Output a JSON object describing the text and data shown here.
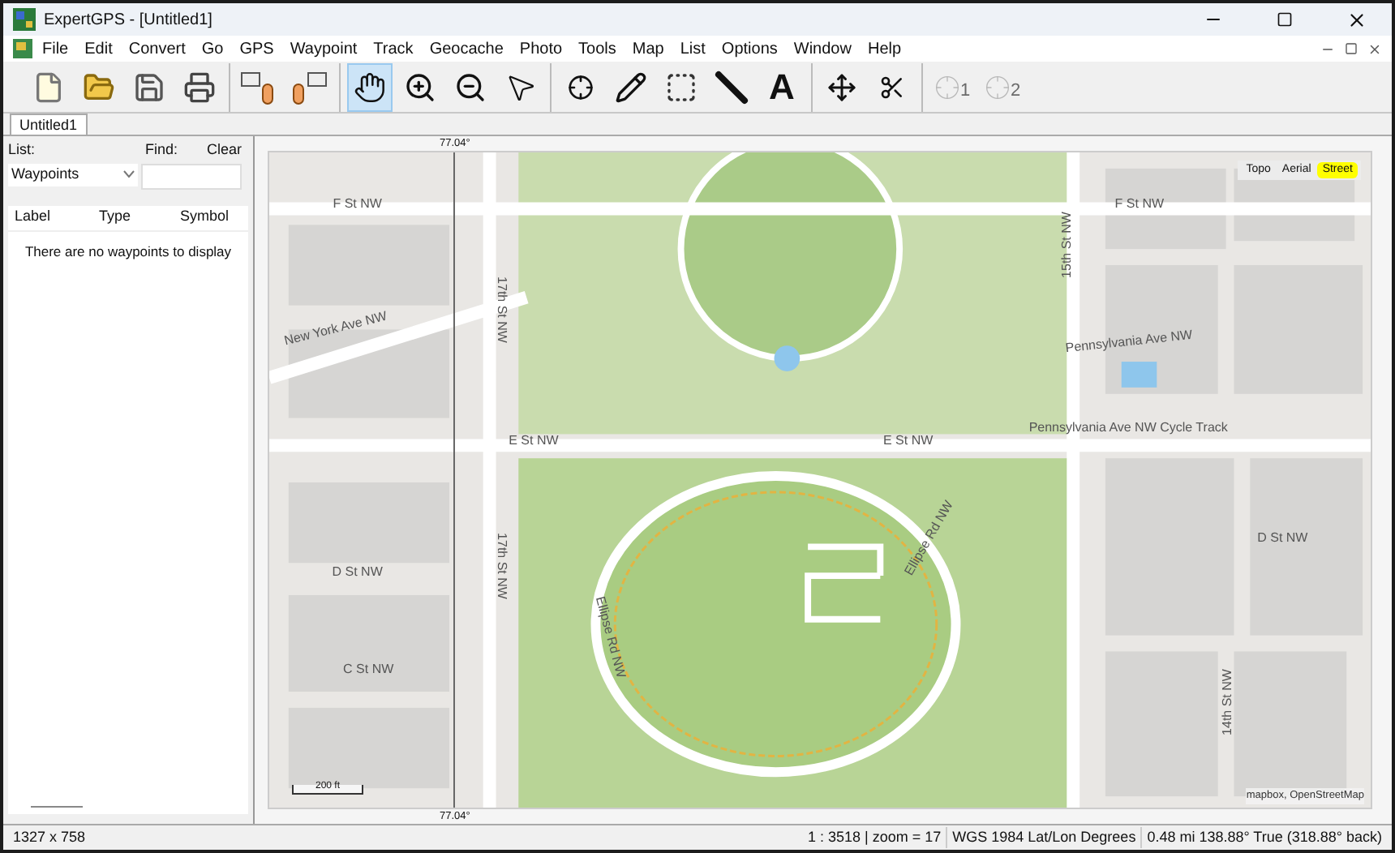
{
  "window": {
    "title": "ExpertGPS - [Untitled1]"
  },
  "menu": [
    "File",
    "Edit",
    "Convert",
    "Go",
    "GPS",
    "Waypoint",
    "Track",
    "Geocache",
    "Photo",
    "Tools",
    "Map",
    "List",
    "Options",
    "Window",
    "Help"
  ],
  "toolbar": [
    [
      {
        "kind": "new",
        "selected": false,
        "disabled": false
      },
      {
        "kind": "open",
        "selected": false,
        "disabled": false
      },
      {
        "kind": "save",
        "selected": false,
        "disabled": false
      },
      {
        "kind": "print",
        "selected": false,
        "disabled": false
      }
    ],
    [
      {
        "kind": "send",
        "selected": false,
        "disabled": false
      },
      {
        "kind": "receive",
        "selected": false,
        "disabled": false
      }
    ],
    [
      {
        "kind": "hand",
        "selected": true,
        "disabled": false
      },
      {
        "kind": "zoom-in",
        "selected": false,
        "disabled": false
      },
      {
        "kind": "zoom-out",
        "selected": false,
        "disabled": false
      },
      {
        "kind": "pointer",
        "selected": false,
        "disabled": false
      }
    ],
    [
      {
        "kind": "crosshair",
        "selected": false,
        "disabled": false
      },
      {
        "kind": "pencil",
        "selected": false,
        "disabled": false
      },
      {
        "kind": "rect",
        "selected": false,
        "disabled": false
      },
      {
        "kind": "ruler",
        "selected": false,
        "disabled": false
      },
      {
        "kind": "text",
        "label": "A",
        "selected": false,
        "disabled": false
      }
    ],
    [
      {
        "kind": "move",
        "selected": false,
        "disabled": false
      },
      {
        "kind": "scissors",
        "selected": false,
        "disabled": false
      }
    ],
    [
      {
        "kind": "point",
        "label": "1",
        "selected": false,
        "disabled": true
      },
      {
        "kind": "point",
        "label": "2",
        "selected": false,
        "disabled": true
      }
    ]
  ],
  "doc_tabs": [
    {
      "label": "Untitled1",
      "selected": true
    }
  ],
  "sidebar": {
    "list_label": "List:",
    "list_value": "Waypoints",
    "find_label": "Find:",
    "clear": "Clear",
    "columns": [
      "Label",
      "Type",
      "Symbol"
    ],
    "empty_message": "There are no waypoints to display"
  },
  "map": {
    "top_label": "77.04°",
    "bottom_label": "77.04°",
    "layers": [
      {
        "label": "Topo",
        "selected": false
      },
      {
        "label": "Aerial",
        "selected": false
      },
      {
        "label": "Street",
        "selected": true
      }
    ],
    "scale": "200 ft",
    "attribution": "mapbox, OpenStreetMap",
    "labels": [
      "F St NW",
      "F St NW",
      "New York Ave NW",
      "Pennsylvania Ave NW",
      "Pennsylvania Ave NW Cycle Track",
      "E St NW",
      "E St NW",
      "D St NW",
      "D St NW",
      "C St NW",
      "17th St NW",
      "17th St NW",
      "15th St NW",
      "14th St NW",
      "Ellipse Rd NW",
      "Ellipse Rd NW"
    ]
  },
  "status_bar": [
    "1327 x 758",
    "1 : 3518 | zoom = 17",
    "WGS 1984 Lat/Lon Degrees",
    "0.48 mi 138.88° True (318.88° back)"
  ]
}
